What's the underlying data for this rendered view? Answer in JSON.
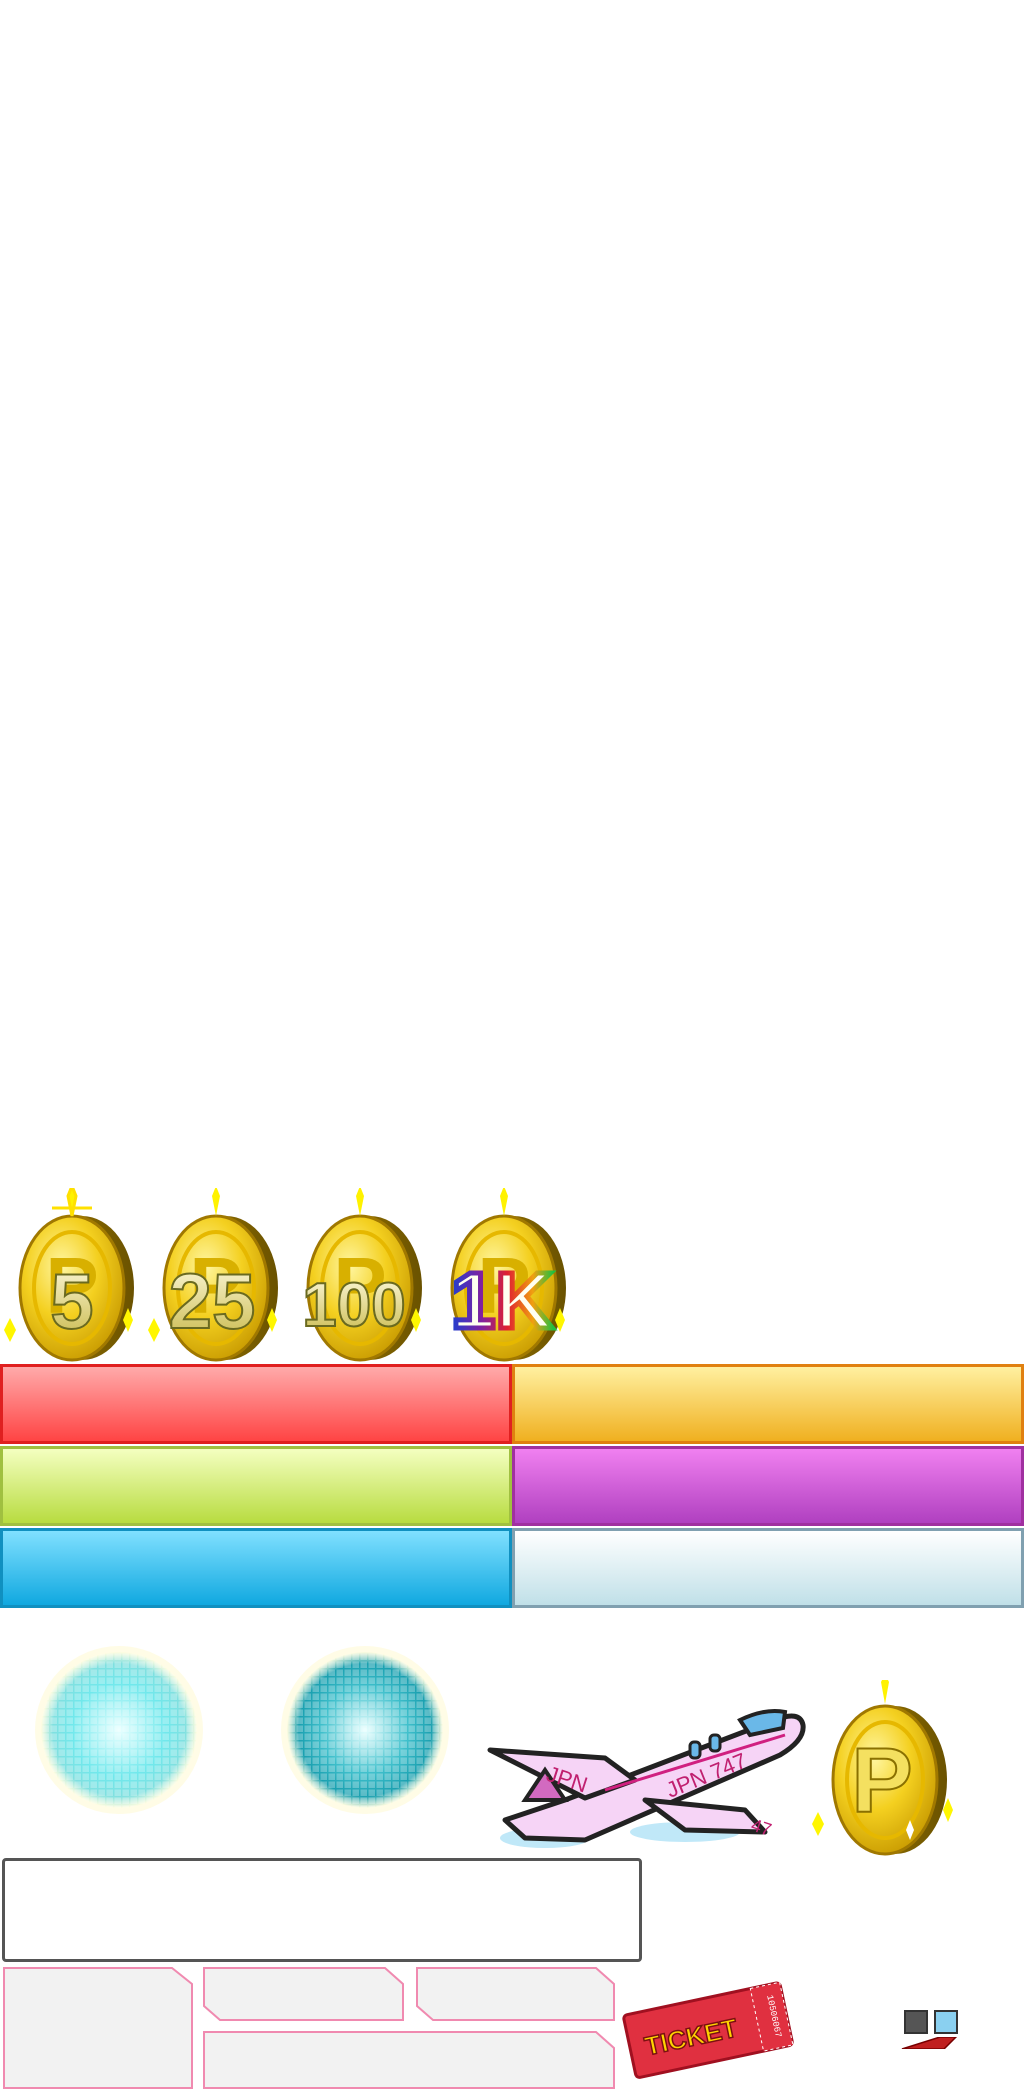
{
  "coins": [
    {
      "label": "5",
      "icon": "gold-p-coin-icon"
    },
    {
      "label": "25",
      "icon": "gold-p-coin-icon"
    },
    {
      "label": "100",
      "icon": "gold-p-coin-icon"
    },
    {
      "label": "1K",
      "icon": "gold-p-coin-icon",
      "style": "rainbow"
    }
  ],
  "bars": [
    {
      "name": "red-bar",
      "top": "#ffaaaa",
      "bottom": "#ff4444",
      "border": "#e02020"
    },
    {
      "name": "orange-bar",
      "top": "#fff0a0",
      "bottom": "#f0b020",
      "border": "#e08010"
    },
    {
      "name": "green-bar",
      "top": "#f4ffc0",
      "bottom": "#b8dc40",
      "border": "#a0c040"
    },
    {
      "name": "purple-bar",
      "top": "#f080f0",
      "bottom": "#b040c0",
      "border": "#a030a0"
    },
    {
      "name": "blue-bar",
      "top": "#80e0ff",
      "bottom": "#10a8e0",
      "border": "#1090c0"
    },
    {
      "name": "light-bar",
      "top": "#ffffff",
      "bottom": "#c0e0e8",
      "border": "#80a0b0"
    }
  ],
  "decor": {
    "ball_1": "disco-ball-light-icon",
    "ball_2": "disco-ball-teal-icon",
    "plane": "airplane-icon",
    "plane_wing_text": "JPN",
    "plane_body_text": "JPN 747",
    "plane_tail_text": "47",
    "p_coin": "gold-p-coin-icon",
    "p_letter": "P",
    "ticket": "ticket-icon",
    "ticket_label": "TICKET",
    "ticket_serial": "10506067",
    "rocket": "rocket-icon"
  }
}
